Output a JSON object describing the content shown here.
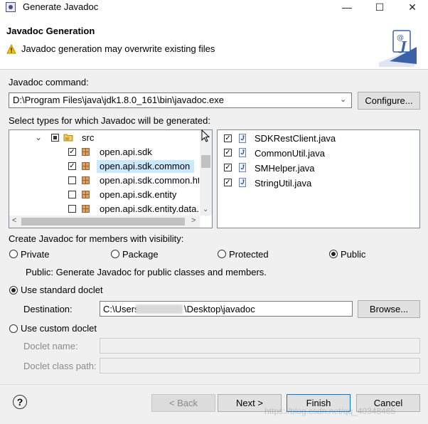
{
  "window": {
    "title": "Generate Javadoc",
    "minimize": "—",
    "maximize": "☐",
    "close": "✕"
  },
  "banner": {
    "title": "Javadoc Generation",
    "message": "Javadoc generation may overwrite existing files"
  },
  "command": {
    "label": "Javadoc command:",
    "value": "D:\\Program Files\\java\\jdk1.8.0_161\\bin\\javadoc.exe",
    "configure_label": "Configure..."
  },
  "types": {
    "label": "Select types for which Javadoc will be generated:",
    "tree": {
      "root": "src",
      "items": [
        {
          "label": "open.api.sdk",
          "checked": true
        },
        {
          "label": "open.api.sdk.common",
          "checked": true,
          "selected": true
        },
        {
          "label": "open.api.sdk.common.ht",
          "checked": false
        },
        {
          "label": "open.api.sdk.entity",
          "checked": false
        },
        {
          "label": "open.api.sdk.entity.data.",
          "checked": false
        }
      ]
    },
    "files": [
      {
        "label": "SDKRestClient.java",
        "checked": true
      },
      {
        "label": "CommonUtil.java",
        "checked": true
      },
      {
        "label": "SMHelper.java",
        "checked": true
      },
      {
        "label": "StringUtil.java",
        "checked": true
      }
    ]
  },
  "visibility": {
    "label": "Create Javadoc for members with visibility:",
    "options": [
      "Private",
      "Package",
      "Protected",
      "Public"
    ],
    "selected": "Public",
    "description": "Public: Generate Javadoc for public classes and members."
  },
  "standard_doclet": {
    "label": "Use standard doclet",
    "destination_label": "Destination:",
    "destination_prefix": "C:\\Users",
    "destination_suffix": "\\Desktop\\javadoc",
    "browse_label": "Browse..."
  },
  "custom_doclet": {
    "label": "Use custom doclet",
    "name_label": "Doclet name:",
    "class_path_label": "Doclet class path:"
  },
  "footer": {
    "help": "?",
    "back": "< Back",
    "next": "Next >",
    "finish": "Finish",
    "cancel": "Cancel",
    "watermark": "https://blog.csdn.net/qq_40348465"
  }
}
